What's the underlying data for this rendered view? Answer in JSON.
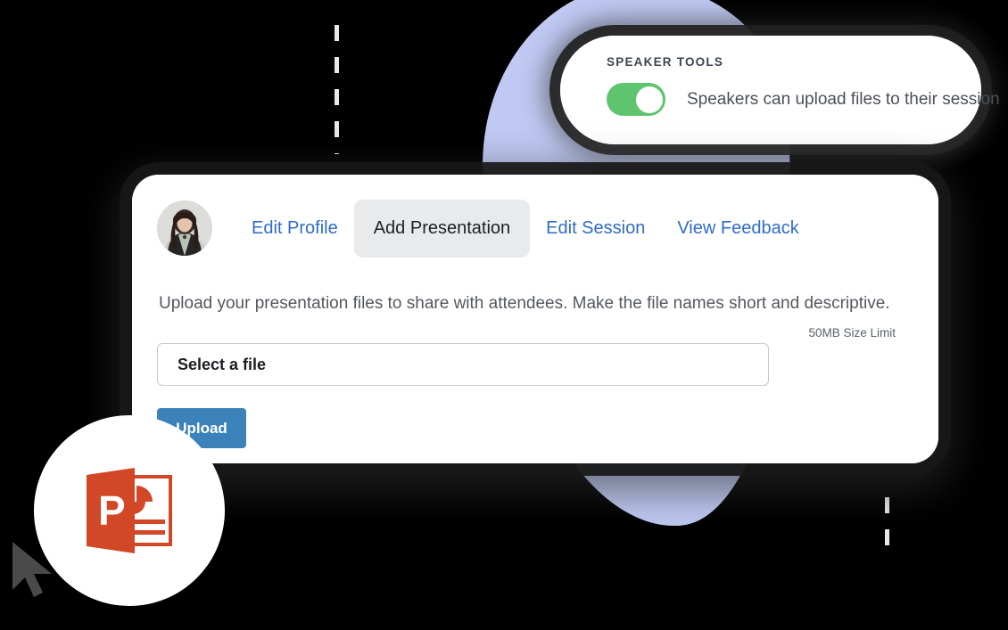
{
  "colors": {
    "background": "#000000",
    "blob": "#bfc9f2",
    "toggle_on": "#5ec46e",
    "link_blue": "#2f6cc4",
    "active_tab_bg": "#e8eaec",
    "upload_button": "#3c82ba",
    "powerpoint_orange": "#d24726",
    "dash_line": "#e9e9e9",
    "card_white": "#ffffff"
  },
  "speaker_tools": {
    "heading": "SPEAKER TOOLS",
    "toggle": {
      "name": "speakers-upload-toggle",
      "state": "on",
      "label": "Speakers can upload files to their session"
    }
  },
  "main_card": {
    "avatar_alt": "Speaker profile photo",
    "tabs": [
      {
        "label": "Edit Profile",
        "active": false
      },
      {
        "label": "Add Presentation",
        "active": true
      },
      {
        "label": "Edit Session",
        "active": false
      },
      {
        "label": "View Feedback",
        "active": false
      }
    ],
    "description": "Upload your presentation files to share with attendees. Make the file names short and descriptive.",
    "size_limit": "50MB Size Limit",
    "file_input": {
      "value": "Select a file",
      "placeholder": "Select a file"
    },
    "upload_button_label": "Upload"
  },
  "decor": {
    "ppt_badge_icon": "powerpoint-file-icon",
    "cursor_icon": "mouse-cursor-icon",
    "dashed_guides": 2
  }
}
